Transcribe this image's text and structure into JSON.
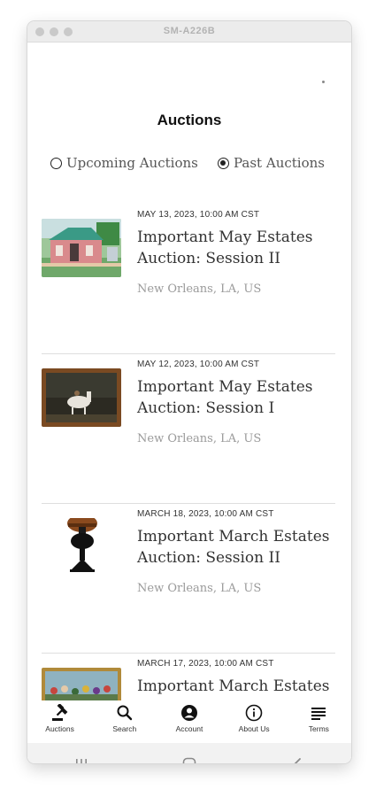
{
  "window": {
    "title": "SM-A226B"
  },
  "page": {
    "title": "Auctions"
  },
  "filters": {
    "upcoming_label": "Upcoming Auctions",
    "past_label": "Past Auctions",
    "selected": "past"
  },
  "auctions": [
    {
      "date": "MAY 13, 2023, 10:00 AM CST",
      "name": "Important May Estates Auction: Session II",
      "location": "New Orleans, LA, US",
      "thumb": "house-painting"
    },
    {
      "date": "MAY 12, 2023, 10:00 AM CST",
      "name": "Important May Estates Auction: Session I",
      "location": "New Orleans, LA, US",
      "thumb": "horse-painting"
    },
    {
      "date": "MARCH 18, 2023, 10:00 AM CST",
      "name": "Important March Estates Auction: Session II",
      "location": "New Orleans, LA, US",
      "thumb": "oil-lamp"
    },
    {
      "date": "MARCH 17, 2023, 10:00 AM CST",
      "name": "Important March Estates",
      "location": "",
      "thumb": "crowd-painting"
    }
  ],
  "tabs": [
    {
      "label": "Auctions",
      "icon": "gavel-icon",
      "active": true
    },
    {
      "label": "Search",
      "icon": "search-icon",
      "active": false
    },
    {
      "label": "Account",
      "icon": "account-icon",
      "active": false
    },
    {
      "label": "About Us",
      "icon": "info-icon",
      "active": false
    },
    {
      "label": "Terms",
      "icon": "terms-icon",
      "active": false
    }
  ],
  "system_nav": [
    {
      "icon": "recent-apps-icon"
    },
    {
      "icon": "home-icon"
    },
    {
      "icon": "back-icon"
    }
  ]
}
